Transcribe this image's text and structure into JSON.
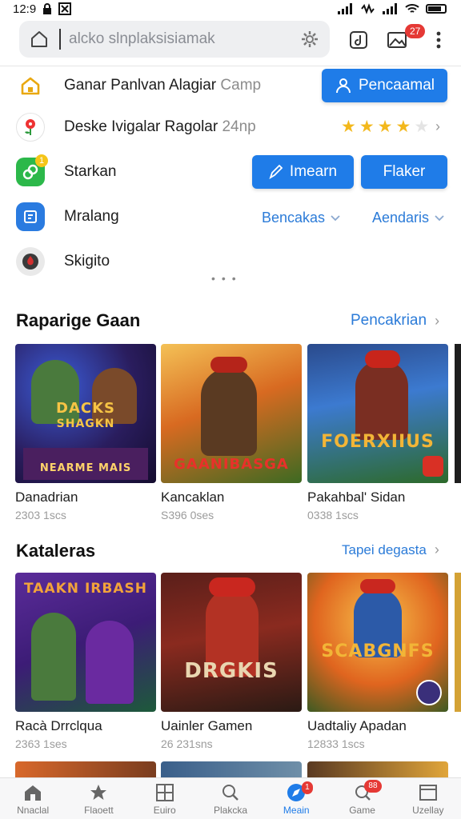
{
  "status_bar": {
    "time": "12:9"
  },
  "browser": {
    "address": "alcko slnplaksisiamak",
    "tab_badge": "27"
  },
  "rows": [
    {
      "label": "Ganar Panlvan Alagiar",
      "label_muted": "Camp",
      "button": "Pencaamal"
    },
    {
      "label": "Deske Ivigalar Ragolar",
      "label_muted": "24np",
      "stars_filled": 4,
      "stars_total": 5
    },
    {
      "label": "Starkan",
      "icon_badge": "1",
      "button_primary": "Imearn",
      "button_secondary": "Flaker"
    },
    {
      "label": "Mralang",
      "link_1": "Bencakas",
      "link_2": "Aendaris"
    },
    {
      "label": "Skigito"
    }
  ],
  "section_1": {
    "title": "Raparige Gaan",
    "link": "Pencakrian",
    "cards": [
      {
        "title": "Danadrian",
        "sub": "2303 1scs",
        "art_top": "DACKS",
        "art_mid": "SHAGKN",
        "art_bottom": "NEARME MAIS"
      },
      {
        "title": "Kancaklan",
        "sub": "S396 0ses",
        "art_mid": "GAANIBASGA"
      },
      {
        "title": "Pakahbal' Sidan",
        "sub": "0338 1scs",
        "art_mid": "FOERXIIUS"
      }
    ]
  },
  "section_2": {
    "title": "Kataleras",
    "link": "Tapei degasta",
    "cards": [
      {
        "title": "Racà Drrclqua",
        "sub": "2363 1ses",
        "art_top": "TAAKN IRBASH"
      },
      {
        "title": "Uainler Gamen",
        "sub": "26 231sns",
        "art_mid": "DRGKIS"
      },
      {
        "title": "Uadtaliy Apadan",
        "sub": "12833 1scs",
        "art_mid": "SCABGNFS"
      }
    ]
  },
  "bottom_nav": [
    {
      "label": "Nnaclal",
      "icon": "home-icon"
    },
    {
      "label": "Flaoett",
      "icon": "star-icon"
    },
    {
      "label": "Euiro",
      "icon": "grid-icon"
    },
    {
      "label": "Plakcka",
      "icon": "search-icon"
    },
    {
      "label": "Meain",
      "icon": "compass-icon",
      "badge": "1",
      "active": true
    },
    {
      "label": "Game",
      "icon": "chat-search-icon",
      "badge": "88"
    },
    {
      "label": "Uzellay",
      "icon": "window-icon"
    }
  ],
  "colors": {
    "accent": "#1f7ce8",
    "badge": "#e53935",
    "star": "#f3b81c"
  }
}
